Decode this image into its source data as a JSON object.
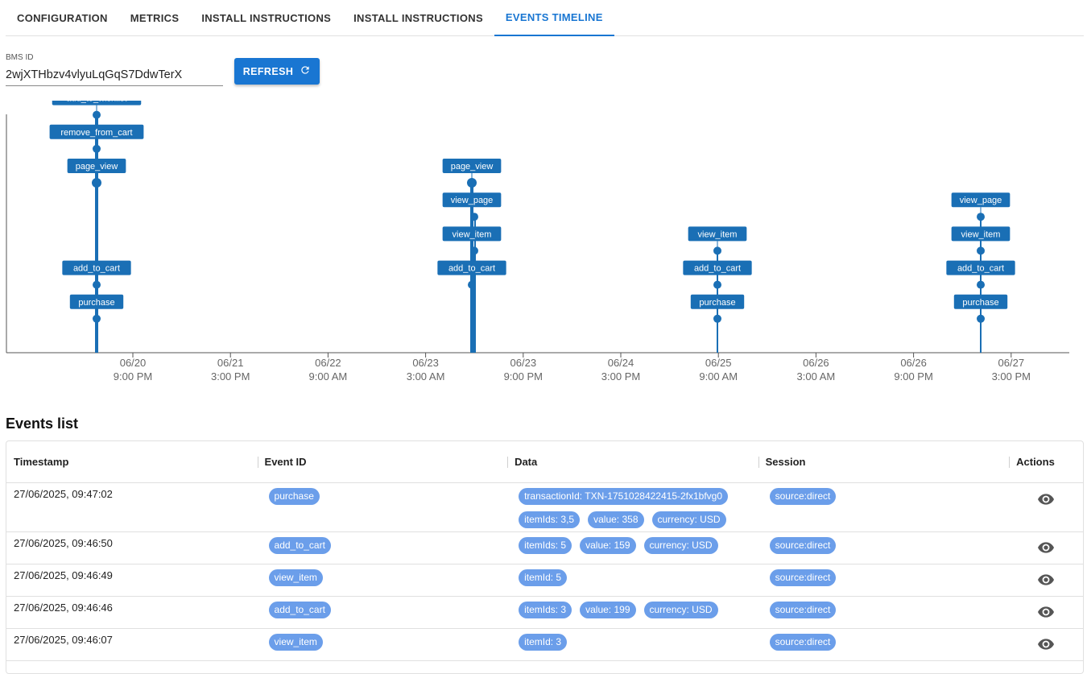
{
  "tabs": [
    {
      "label": "CONFIGURATION",
      "active": false
    },
    {
      "label": "METRICS",
      "active": false
    },
    {
      "label": "INSTALL INSTRUCTIONS",
      "active": false
    },
    {
      "label": "INSTALL INSTRUCTIONS",
      "active": false
    },
    {
      "label": "EVENTS TIMELINE",
      "active": true
    }
  ],
  "bms": {
    "label": "BMS ID",
    "value": "2wjXTHbzv4vlyuLqGqS7DdwTerX"
  },
  "refresh": {
    "label": "REFRESH",
    "icon": "refresh-icon"
  },
  "colors": {
    "accent": "#1976d2",
    "chip": "#6b9eea",
    "timeline": "#1a6fb5"
  },
  "chart_data": {
    "type": "scatter",
    "x_ticks": [
      {
        "date": "06/20",
        "time": "9:00 PM"
      },
      {
        "date": "06/21",
        "time": "3:00 PM"
      },
      {
        "date": "06/22",
        "time": "9:00 AM"
      },
      {
        "date": "06/23",
        "time": "3:00 AM"
      },
      {
        "date": "06/23",
        "time": "9:00 PM"
      },
      {
        "date": "06/24",
        "time": "3:00 PM"
      },
      {
        "date": "06/25",
        "time": "9:00 AM"
      },
      {
        "date": "06/26",
        "time": "3:00 AM"
      },
      {
        "date": "06/26",
        "time": "9:00 PM"
      },
      {
        "date": "06/27",
        "time": "3:00 PM"
      }
    ],
    "clusters": [
      {
        "approx_time": "06/20 ~6:00 PM",
        "events": [
          "purchase",
          "add_to_cart",
          "page_view",
          "remove_from_cart",
          "add_to_wishlist"
        ],
        "stack_levels": [
          1,
          2,
          5,
          6,
          7
        ]
      },
      {
        "approx_time": "06/23 ~12:00 PM",
        "events": [
          "add_to_cart",
          "view_item",
          "view_page",
          "page_view"
        ],
        "stack_levels": [
          2,
          3,
          4,
          5
        ]
      },
      {
        "approx_time": "06/25 ~9:00 AM",
        "events": [
          "purchase",
          "add_to_cart",
          "view_item"
        ],
        "stack_levels": [
          1,
          2,
          3
        ]
      },
      {
        "approx_time": "06/27 ~9:45 AM",
        "events": [
          "purchase",
          "add_to_cart",
          "view_item",
          "view_page"
        ],
        "stack_levels": [
          1,
          2,
          3,
          4
        ]
      }
    ]
  },
  "events": {
    "title": "Events list",
    "columns": [
      "Timestamp",
      "Event ID",
      "Data",
      "Session",
      "Actions"
    ],
    "rows": [
      {
        "timestamp": "27/06/2025, 09:47:02",
        "event_id": "purchase",
        "data": [
          "transactionId: TXN-1751028422415-2fx1bfvg0",
          "itemIds: 3,5",
          "value: 358",
          "currency: USD"
        ],
        "session": "source:direct",
        "action_icon": "eye-icon"
      },
      {
        "timestamp": "27/06/2025, 09:46:50",
        "event_id": "add_to_cart",
        "data": [
          "itemIds: 5",
          "value: 159",
          "currency: USD"
        ],
        "session": "source:direct",
        "action_icon": "eye-icon"
      },
      {
        "timestamp": "27/06/2025, 09:46:49",
        "event_id": "view_item",
        "data": [
          "itemId: 5"
        ],
        "session": "source:direct",
        "action_icon": "eye-icon"
      },
      {
        "timestamp": "27/06/2025, 09:46:46",
        "event_id": "add_to_cart",
        "data": [
          "itemIds: 3",
          "value: 199",
          "currency: USD"
        ],
        "session": "source:direct",
        "action_icon": "eye-icon"
      },
      {
        "timestamp": "27/06/2025, 09:46:07",
        "event_id": "view_item",
        "data": [
          "itemId: 3"
        ],
        "session": "source:direct",
        "action_icon": "eye-icon"
      }
    ]
  }
}
